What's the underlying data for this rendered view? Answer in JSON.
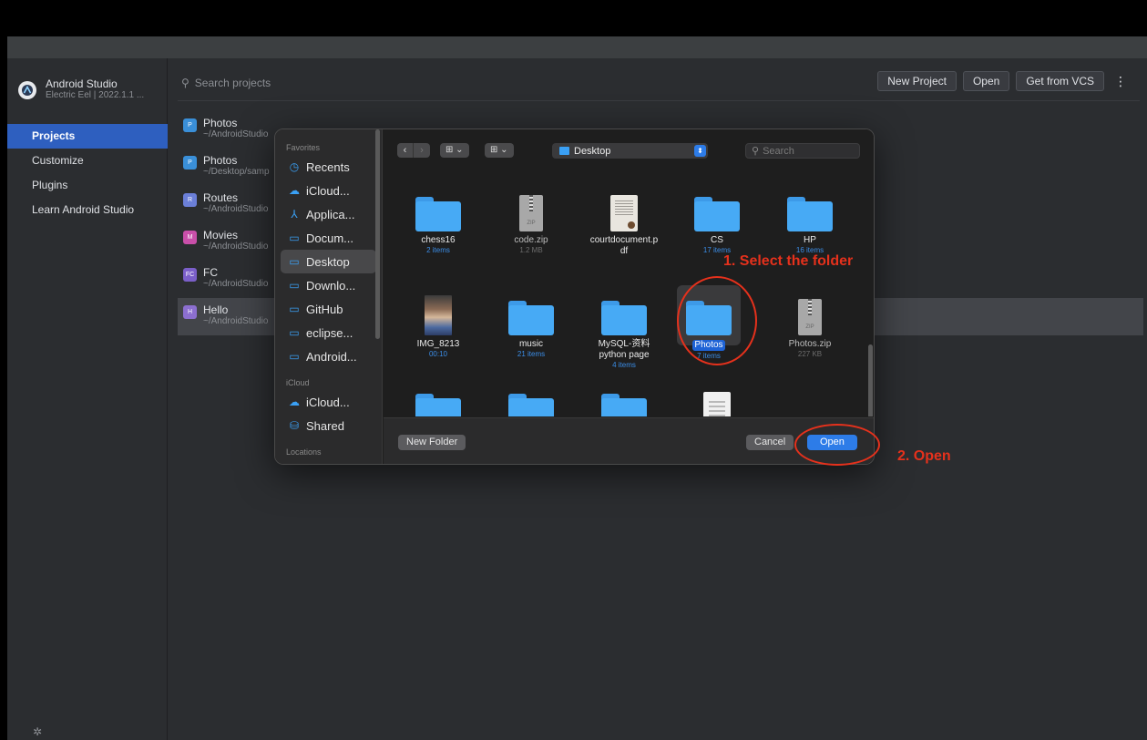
{
  "app": {
    "name": "Android Studio",
    "version": "Electric Eel | 2022.1.1 ..."
  },
  "sidebar": {
    "items": [
      {
        "label": "Projects",
        "active": true
      },
      {
        "label": "Customize",
        "active": false
      },
      {
        "label": "Plugins",
        "active": false
      },
      {
        "label": "Learn Android Studio",
        "active": false
      }
    ]
  },
  "main": {
    "search_placeholder": "Search projects",
    "actions": {
      "new_project": "New Project",
      "open": "Open",
      "get_from_vcs": "Get from VCS",
      "more": "⋮"
    },
    "projects": [
      {
        "badge": "P",
        "name": "Photos",
        "path": "~/AndroidStudio",
        "color": "#3a8fd8"
      },
      {
        "badge": "P",
        "name": "Photos",
        "path": "~/Desktop/samp",
        "color": "#3a8fd8"
      },
      {
        "badge": "R",
        "name": "Routes",
        "path": "~/AndroidStudio",
        "color": "#6b7fd8"
      },
      {
        "badge": "M",
        "name": "Movies",
        "path": "~/AndroidStudio",
        "color": "#c94fa9"
      },
      {
        "badge": "FC",
        "name": "FC",
        "path": "~/AndroidStudio",
        "color": "#7b5fc9"
      },
      {
        "badge": "H",
        "name": "Hello",
        "path": "~/AndroidStudio",
        "color": "#8c6fd0"
      }
    ]
  },
  "dialog": {
    "sidebar": {
      "favorites_label": "Favorites",
      "favorites": [
        {
          "icon": "◷",
          "label": "Recents"
        },
        {
          "icon": "☁",
          "label": "iCloud..."
        },
        {
          "icon": "⅄",
          "label": "Applica..."
        },
        {
          "icon": "▭",
          "label": "Docum..."
        },
        {
          "icon": "▭",
          "label": "Desktop"
        },
        {
          "icon": "▭",
          "label": "Downlo..."
        },
        {
          "icon": "▭",
          "label": "GitHub"
        },
        {
          "icon": "▭",
          "label": "eclipse..."
        },
        {
          "icon": "▭",
          "label": "Android..."
        }
      ],
      "icloud_label": "iCloud",
      "icloud": [
        {
          "icon": "☁",
          "label": "iCloud..."
        },
        {
          "icon": "⛁",
          "label": "Shared"
        }
      ],
      "locations_label": "Locations"
    },
    "toolbar": {
      "back": "‹",
      "forward": "›",
      "view_icons": "⊞ ⌄",
      "group": "⊞ ⌄",
      "location": "Desktop",
      "location_arrow": "⬍",
      "search_placeholder": "Search"
    },
    "files": [
      {
        "name": "chess16",
        "meta": "2 items",
        "kind": "folder"
      },
      {
        "name": "code.zip",
        "meta": "1.2 MB",
        "kind": "zip"
      },
      {
        "name": "courtdocument.p",
        "name2": "df",
        "meta": "",
        "kind": "doc"
      },
      {
        "name": "CS",
        "meta": "17 items",
        "kind": "folder"
      },
      {
        "name": "HP",
        "meta": "16 items",
        "kind": "folder"
      },
      {
        "name": "IMG_8213",
        "meta": "00:10",
        "kind": "photo"
      },
      {
        "name": "music",
        "meta": "21 items",
        "kind": "folder"
      },
      {
        "name": "MySQL-资料",
        "name2": "python page",
        "meta": "4 items",
        "kind": "folder"
      },
      {
        "name": "Photos",
        "meta": "7 items",
        "kind": "folder",
        "selected": true
      },
      {
        "name": "Photos.zip",
        "meta": "227 KB",
        "kind": "zip"
      },
      {
        "name": "",
        "meta": "",
        "kind": "folder"
      },
      {
        "name": "",
        "meta": "",
        "kind": "folder"
      },
      {
        "name": "",
        "meta": "",
        "kind": "folder"
      },
      {
        "name": "",
        "meta": "",
        "kind": "page"
      }
    ],
    "footer": {
      "new_folder": "New Folder",
      "cancel": "Cancel",
      "open": "Open"
    }
  },
  "annotations": {
    "step1": "1. Select the folder",
    "step2": "2. Open"
  },
  "colors": {
    "accent": "#2e5fbf",
    "mac_blue": "#2d7ce8",
    "annotation": "#e5311c"
  }
}
